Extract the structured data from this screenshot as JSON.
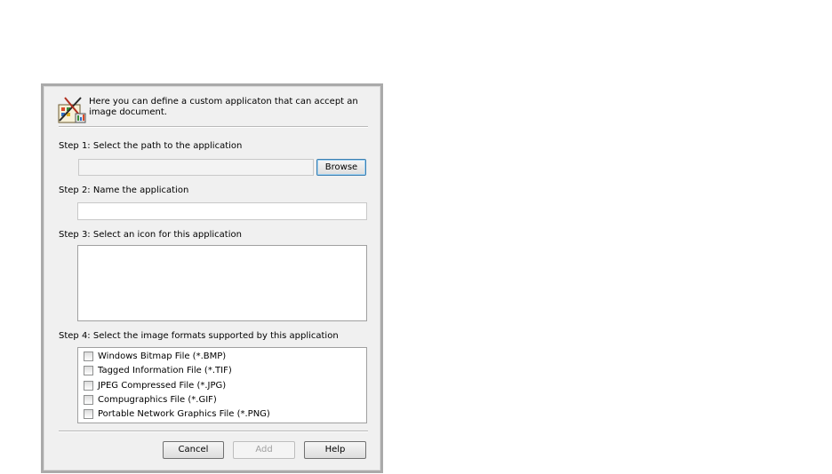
{
  "header": {
    "icon": "application-wizard-icon",
    "text": "Here you can define a custom applicaton that can accept an image document."
  },
  "step1": {
    "label": "Step 1: Select the path to the application",
    "path_value": "",
    "browse_label": "Browse"
  },
  "step2": {
    "label": "Step 2: Name the application",
    "name_value": ""
  },
  "step3": {
    "label": "Step 3: Select an icon for this application"
  },
  "step4": {
    "label": "Step 4: Select the image formats supported by this application",
    "formats": [
      {
        "label": "Windows Bitmap File (*.BMP)",
        "checked": false
      },
      {
        "label": "Tagged Information File (*.TIF)",
        "checked": false
      },
      {
        "label": "JPEG Compressed File (*.JPG)",
        "checked": false
      },
      {
        "label": "Compugraphics File (*.GIF)",
        "checked": false
      },
      {
        "label": "Portable Network Graphics File (*.PNG)",
        "checked": false
      }
    ]
  },
  "buttons": {
    "cancel": "Cancel",
    "add": "Add",
    "help": "Help"
  }
}
